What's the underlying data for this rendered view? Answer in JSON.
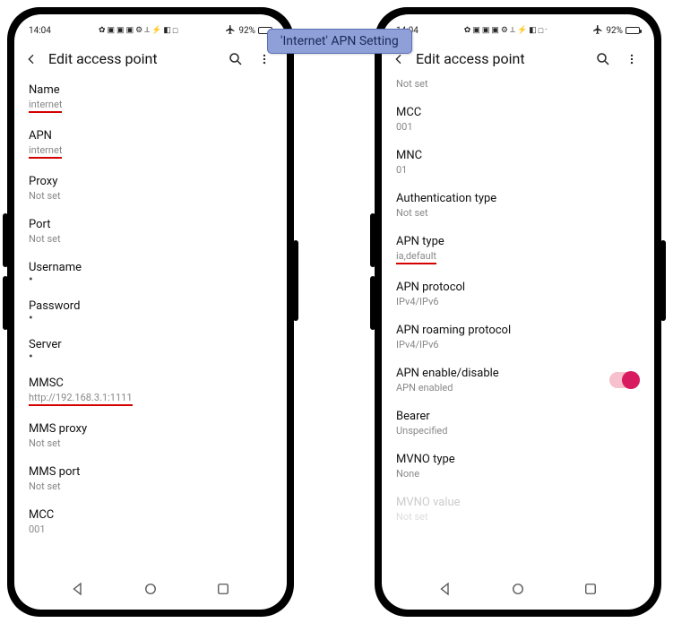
{
  "callout": {
    "text": "'Internet' APN Setting"
  },
  "statusbar": {
    "time": "14:04",
    "battery_pct": "92%"
  },
  "appbar": {
    "title": "Edit access point"
  },
  "left_phone": {
    "items": [
      {
        "label": "Name",
        "value": "internet",
        "underline": true
      },
      {
        "label": "APN",
        "value": "internet",
        "underline": true
      },
      {
        "label": "Proxy",
        "value": "Not set"
      },
      {
        "label": "Port",
        "value": "Not set"
      },
      {
        "label": "Username",
        "value": "•",
        "dot": true
      },
      {
        "label": "Password",
        "value": "•",
        "dot": true
      },
      {
        "label": "Server",
        "value": "•",
        "dot": true
      },
      {
        "label": "MMSC",
        "value": "http://192.168.3.1:1111",
        "underline": true
      },
      {
        "label": "MMS proxy",
        "value": "Not set"
      },
      {
        "label": "MMS port",
        "value": "Not set"
      },
      {
        "label": "MCC",
        "value": "001"
      }
    ]
  },
  "right_phone": {
    "prev_value": "Not set",
    "items": [
      {
        "label": "MCC",
        "value": "001"
      },
      {
        "label": "MNC",
        "value": "01"
      },
      {
        "label": "Authentication type",
        "value": "Not set"
      },
      {
        "label": "APN type",
        "value": "ia,default",
        "underline": true
      },
      {
        "label": "APN protocol",
        "value": "IPv4/IPv6"
      },
      {
        "label": "APN roaming protocol",
        "value": "IPv4/IPv6"
      },
      {
        "label": "APN enable/disable",
        "value": "APN enabled",
        "toggle": true,
        "toggle_on": true
      },
      {
        "label": "Bearer",
        "value": "Unspecified"
      },
      {
        "label": "MVNO type",
        "value": "None"
      },
      {
        "label": "MVNO value",
        "value": "Not set",
        "disabled": true
      }
    ]
  }
}
